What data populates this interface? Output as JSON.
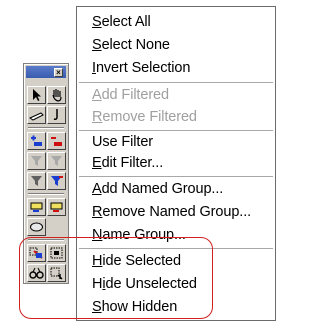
{
  "menu": {
    "items": [
      {
        "pre": "",
        "u": "S",
        "post": "elect All",
        "disabled": false
      },
      {
        "pre": "",
        "u": "S",
        "post": "elect None",
        "disabled": false
      },
      {
        "pre": "",
        "u": "I",
        "post": "nvert Selection",
        "disabled": false
      },
      {
        "pre": "",
        "u": "A",
        "post": "dd Filtered",
        "disabled": true
      },
      {
        "pre": "",
        "u": "R",
        "post": "emove Filtered",
        "disabled": true
      },
      {
        "pre": "Use Filter",
        "u": "",
        "post": "",
        "disabled": false
      },
      {
        "pre": "",
        "u": "E",
        "post": "dit Filter...",
        "disabled": false
      },
      {
        "pre": "",
        "u": "A",
        "post": "dd Named Group...",
        "disabled": false
      },
      {
        "pre": "",
        "u": "R",
        "post": "emove Named Group...",
        "disabled": false
      },
      {
        "pre": "",
        "u": "N",
        "post": "ame Group...",
        "disabled": false
      },
      {
        "pre": "",
        "u": "H",
        "post": "ide Selected",
        "disabled": false
      },
      {
        "pre": "H",
        "u": "i",
        "post": "de Unselected",
        "disabled": false
      },
      {
        "pre": "",
        "u": "S",
        "post": "how Hidden",
        "disabled": false
      }
    ]
  },
  "toolbar": {
    "close_glyph": "×",
    "buttons": [
      {
        "icon": "arrow-pointer-icon"
      },
      {
        "icon": "hand-pointer-icon"
      },
      {
        "icon": "eraser-icon"
      },
      {
        "icon": "hook-icon"
      },
      {
        "icon": "add-blue-icon"
      },
      {
        "icon": "remove-red-icon"
      },
      {
        "icon": "filter-add-icon"
      },
      {
        "icon": "filter-remove-icon"
      },
      {
        "icon": "filter-icon"
      },
      {
        "icon": "filter-edit-icon"
      },
      {
        "icon": "group-add-icon"
      },
      {
        "icon": "group-remove-icon"
      },
      {
        "icon": "group-name-icon"
      },
      {
        "icon": "hide-selected-icon"
      },
      {
        "icon": "hide-unselected-icon"
      },
      {
        "icon": "binoculars-icon"
      },
      {
        "icon": "show-hidden-icon"
      }
    ]
  },
  "colors": {
    "annotation": "#d02020",
    "disabled_text": "#a0a0a0"
  }
}
